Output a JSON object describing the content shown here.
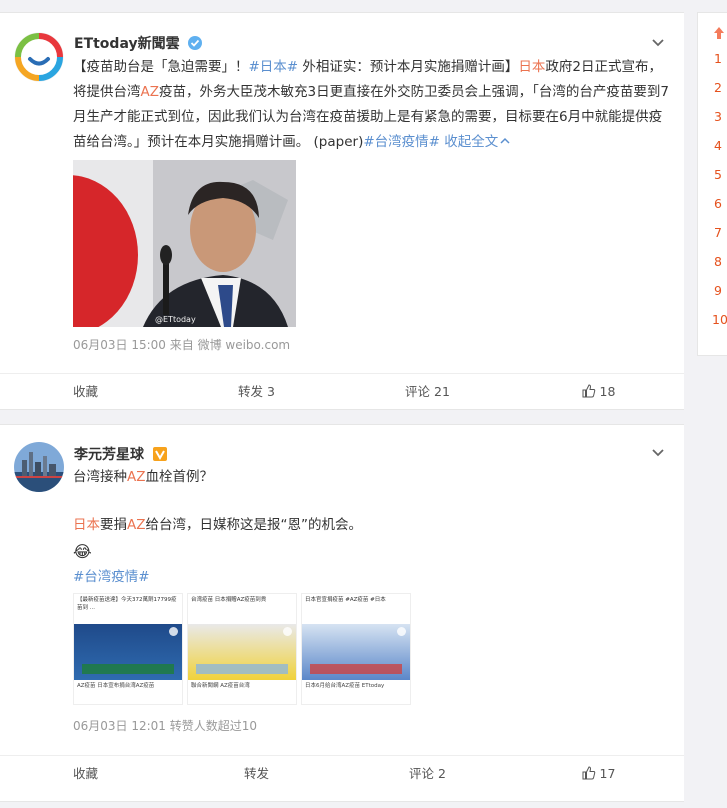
{
  "post1": {
    "author": "ETtoday新聞雲",
    "text_segments": [
      {
        "t": "【疫苗助台是「急迫需要」！",
        "c": ""
      },
      {
        "t": "#日本#",
        "c": "blue"
      },
      {
        "t": " 外相证实：预计本月实施捐赠计画】",
        "c": ""
      },
      {
        "t": "日本",
        "c": "red"
      },
      {
        "t": "政府2日正式宣布，将提供台湾",
        "c": ""
      },
      {
        "t": "AZ",
        "c": "red"
      },
      {
        "t": "疫苗，外务大臣茂木敏充3日更直接在外交防卫委员会上强调，「台湾的台产疫苗要到7月生产才能正式到位，因此我们认为台湾在疫苗援助上是有紧急的需要，目标要在6月中就能提供疫苗给台湾。」预计在本月实施捐赠计画。 (paper)",
        "c": ""
      },
      {
        "t": "#台湾疫情#",
        "c": "blue"
      },
      {
        "t": " 收起全文",
        "c": "blue"
      }
    ],
    "image_watermark": "@ETtoday",
    "meta": "06月03日 15:00  来自 微博 weibo.com",
    "actions": {
      "fav": "收藏",
      "repost": "转发 3",
      "comment": "评论 21",
      "like": "18"
    }
  },
  "post2": {
    "author": "李元芳星球",
    "line1_segments": [
      {
        "t": "台湾接种",
        "c": ""
      },
      {
        "t": "AZ",
        "c": "red"
      },
      {
        "t": "血栓首例？",
        "c": ""
      }
    ],
    "line2_segments": [
      {
        "t": "日本",
        "c": "red"
      },
      {
        "t": "要捐",
        "c": ""
      },
      {
        "t": "AZ",
        "c": "red"
      },
      {
        "t": "给台湾，日媒称这是报“恩”的机会。",
        "c": ""
      }
    ],
    "emoji": "😂",
    "hashtag": "#台湾疫情#",
    "thumbs": [
      {
        "head": "【最新疫苗送達】今天372萬劑17799疫苗到 ...",
        "foot": "AZ疫苗 日本宣布捐台湾AZ疫苗"
      },
      {
        "head": "台湾疫苗 日本捐贈AZ疫苗到貨",
        "foot": "聯合新聞網 AZ疫苗台湾"
      },
      {
        "head": "日本官宣捐疫苗 #AZ疫苗 #日本",
        "foot": "日本6月给台湾AZ疫苗 ETtoday"
      }
    ],
    "meta": "06月03日 12:01  转赞人数超过10",
    "actions": {
      "fav": "收藏",
      "repost": "转发",
      "comment": "评论 2",
      "like": "17"
    }
  },
  "right_panel": {
    "numbers": [
      "1",
      "2",
      "3",
      "4",
      "5",
      "6",
      "7",
      "8",
      "9",
      "10"
    ]
  }
}
